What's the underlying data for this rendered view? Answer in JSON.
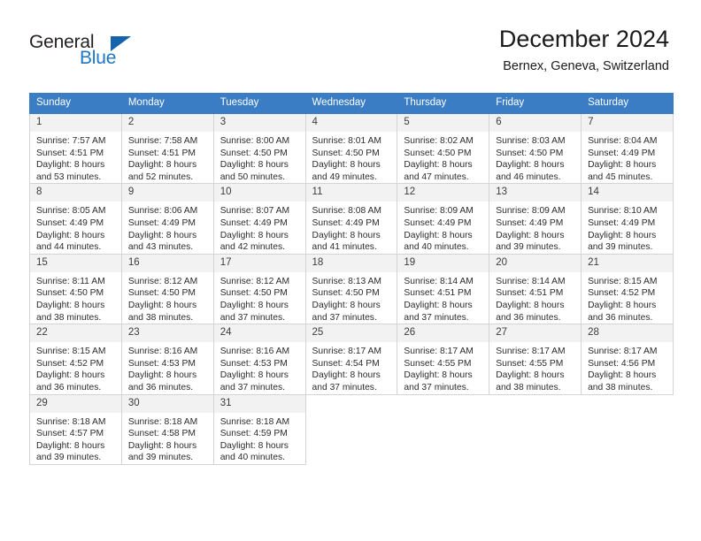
{
  "brand": {
    "name_part1": "General",
    "name_part2": "Blue",
    "triangle_color": "#1464ad",
    "blue_color": "#1f77c2"
  },
  "header": {
    "title": "December 2024",
    "subtitle": "Bernex, Geneva, Switzerland"
  },
  "calendar": {
    "header_bg": "#3b7dc4",
    "daynum_bg": "#f2f2f2",
    "weekdays": [
      "Sunday",
      "Monday",
      "Tuesday",
      "Wednesday",
      "Thursday",
      "Friday",
      "Saturday"
    ],
    "weeks": [
      [
        {
          "day": "1",
          "sunrise": "Sunrise: 7:57 AM",
          "sunset": "Sunset: 4:51 PM",
          "daylight1": "Daylight: 8 hours",
          "daylight2": "and 53 minutes."
        },
        {
          "day": "2",
          "sunrise": "Sunrise: 7:58 AM",
          "sunset": "Sunset: 4:51 PM",
          "daylight1": "Daylight: 8 hours",
          "daylight2": "and 52 minutes."
        },
        {
          "day": "3",
          "sunrise": "Sunrise: 8:00 AM",
          "sunset": "Sunset: 4:50 PM",
          "daylight1": "Daylight: 8 hours",
          "daylight2": "and 50 minutes."
        },
        {
          "day": "4",
          "sunrise": "Sunrise: 8:01 AM",
          "sunset": "Sunset: 4:50 PM",
          "daylight1": "Daylight: 8 hours",
          "daylight2": "and 49 minutes."
        },
        {
          "day": "5",
          "sunrise": "Sunrise: 8:02 AM",
          "sunset": "Sunset: 4:50 PM",
          "daylight1": "Daylight: 8 hours",
          "daylight2": "and 47 minutes."
        },
        {
          "day": "6",
          "sunrise": "Sunrise: 8:03 AM",
          "sunset": "Sunset: 4:50 PM",
          "daylight1": "Daylight: 8 hours",
          "daylight2": "and 46 minutes."
        },
        {
          "day": "7",
          "sunrise": "Sunrise: 8:04 AM",
          "sunset": "Sunset: 4:49 PM",
          "daylight1": "Daylight: 8 hours",
          "daylight2": "and 45 minutes."
        }
      ],
      [
        {
          "day": "8",
          "sunrise": "Sunrise: 8:05 AM",
          "sunset": "Sunset: 4:49 PM",
          "daylight1": "Daylight: 8 hours",
          "daylight2": "and 44 minutes."
        },
        {
          "day": "9",
          "sunrise": "Sunrise: 8:06 AM",
          "sunset": "Sunset: 4:49 PM",
          "daylight1": "Daylight: 8 hours",
          "daylight2": "and 43 minutes."
        },
        {
          "day": "10",
          "sunrise": "Sunrise: 8:07 AM",
          "sunset": "Sunset: 4:49 PM",
          "daylight1": "Daylight: 8 hours",
          "daylight2": "and 42 minutes."
        },
        {
          "day": "11",
          "sunrise": "Sunrise: 8:08 AM",
          "sunset": "Sunset: 4:49 PM",
          "daylight1": "Daylight: 8 hours",
          "daylight2": "and 41 minutes."
        },
        {
          "day": "12",
          "sunrise": "Sunrise: 8:09 AM",
          "sunset": "Sunset: 4:49 PM",
          "daylight1": "Daylight: 8 hours",
          "daylight2": "and 40 minutes."
        },
        {
          "day": "13",
          "sunrise": "Sunrise: 8:09 AM",
          "sunset": "Sunset: 4:49 PM",
          "daylight1": "Daylight: 8 hours",
          "daylight2": "and 39 minutes."
        },
        {
          "day": "14",
          "sunrise": "Sunrise: 8:10 AM",
          "sunset": "Sunset: 4:49 PM",
          "daylight1": "Daylight: 8 hours",
          "daylight2": "and 39 minutes."
        }
      ],
      [
        {
          "day": "15",
          "sunrise": "Sunrise: 8:11 AM",
          "sunset": "Sunset: 4:50 PM",
          "daylight1": "Daylight: 8 hours",
          "daylight2": "and 38 minutes."
        },
        {
          "day": "16",
          "sunrise": "Sunrise: 8:12 AM",
          "sunset": "Sunset: 4:50 PM",
          "daylight1": "Daylight: 8 hours",
          "daylight2": "and 38 minutes."
        },
        {
          "day": "17",
          "sunrise": "Sunrise: 8:12 AM",
          "sunset": "Sunset: 4:50 PM",
          "daylight1": "Daylight: 8 hours",
          "daylight2": "and 37 minutes."
        },
        {
          "day": "18",
          "sunrise": "Sunrise: 8:13 AM",
          "sunset": "Sunset: 4:50 PM",
          "daylight1": "Daylight: 8 hours",
          "daylight2": "and 37 minutes."
        },
        {
          "day": "19",
          "sunrise": "Sunrise: 8:14 AM",
          "sunset": "Sunset: 4:51 PM",
          "daylight1": "Daylight: 8 hours",
          "daylight2": "and 37 minutes."
        },
        {
          "day": "20",
          "sunrise": "Sunrise: 8:14 AM",
          "sunset": "Sunset: 4:51 PM",
          "daylight1": "Daylight: 8 hours",
          "daylight2": "and 36 minutes."
        },
        {
          "day": "21",
          "sunrise": "Sunrise: 8:15 AM",
          "sunset": "Sunset: 4:52 PM",
          "daylight1": "Daylight: 8 hours",
          "daylight2": "and 36 minutes."
        }
      ],
      [
        {
          "day": "22",
          "sunrise": "Sunrise: 8:15 AM",
          "sunset": "Sunset: 4:52 PM",
          "daylight1": "Daylight: 8 hours",
          "daylight2": "and 36 minutes."
        },
        {
          "day": "23",
          "sunrise": "Sunrise: 8:16 AM",
          "sunset": "Sunset: 4:53 PM",
          "daylight1": "Daylight: 8 hours",
          "daylight2": "and 36 minutes."
        },
        {
          "day": "24",
          "sunrise": "Sunrise: 8:16 AM",
          "sunset": "Sunset: 4:53 PM",
          "daylight1": "Daylight: 8 hours",
          "daylight2": "and 37 minutes."
        },
        {
          "day": "25",
          "sunrise": "Sunrise: 8:17 AM",
          "sunset": "Sunset: 4:54 PM",
          "daylight1": "Daylight: 8 hours",
          "daylight2": "and 37 minutes."
        },
        {
          "day": "26",
          "sunrise": "Sunrise: 8:17 AM",
          "sunset": "Sunset: 4:55 PM",
          "daylight1": "Daylight: 8 hours",
          "daylight2": "and 37 minutes."
        },
        {
          "day": "27",
          "sunrise": "Sunrise: 8:17 AM",
          "sunset": "Sunset: 4:55 PM",
          "daylight1": "Daylight: 8 hours",
          "daylight2": "and 38 minutes."
        },
        {
          "day": "28",
          "sunrise": "Sunrise: 8:17 AM",
          "sunset": "Sunset: 4:56 PM",
          "daylight1": "Daylight: 8 hours",
          "daylight2": "and 38 minutes."
        }
      ],
      [
        {
          "day": "29",
          "sunrise": "Sunrise: 8:18 AM",
          "sunset": "Sunset: 4:57 PM",
          "daylight1": "Daylight: 8 hours",
          "daylight2": "and 39 minutes."
        },
        {
          "day": "30",
          "sunrise": "Sunrise: 8:18 AM",
          "sunset": "Sunset: 4:58 PM",
          "daylight1": "Daylight: 8 hours",
          "daylight2": "and 39 minutes."
        },
        {
          "day": "31",
          "sunrise": "Sunrise: 8:18 AM",
          "sunset": "Sunset: 4:59 PM",
          "daylight1": "Daylight: 8 hours",
          "daylight2": "and 40 minutes."
        },
        {
          "day": "",
          "sunrise": "",
          "sunset": "",
          "daylight1": "",
          "daylight2": ""
        },
        {
          "day": "",
          "sunrise": "",
          "sunset": "",
          "daylight1": "",
          "daylight2": ""
        },
        {
          "day": "",
          "sunrise": "",
          "sunset": "",
          "daylight1": "",
          "daylight2": ""
        },
        {
          "day": "",
          "sunrise": "",
          "sunset": "",
          "daylight1": "",
          "daylight2": ""
        }
      ]
    ]
  }
}
